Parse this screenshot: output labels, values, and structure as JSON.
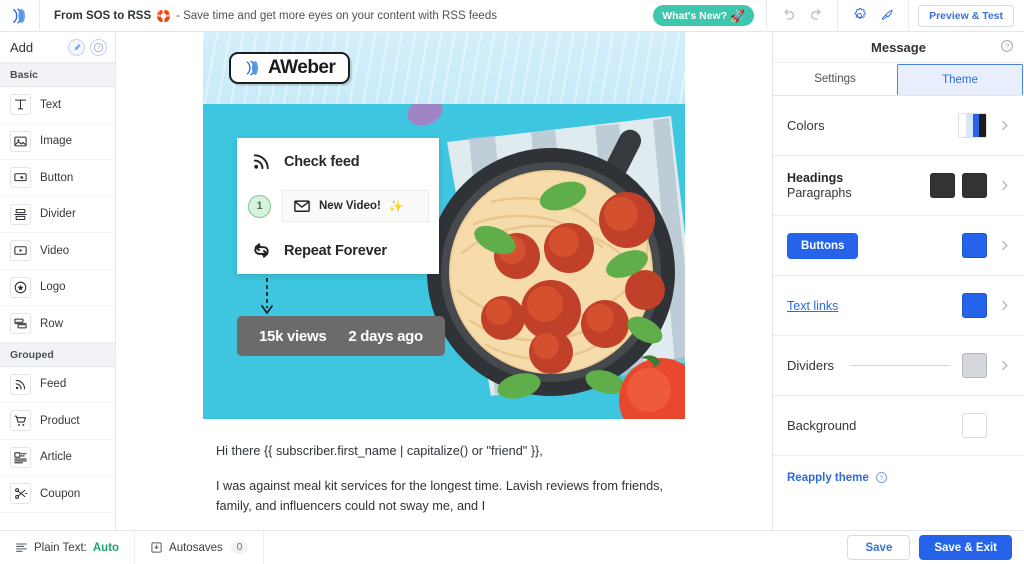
{
  "topbar": {
    "brand_icon": "aweber-logo-icon",
    "subject_strong": "From SOS to RSS",
    "subject_emoji": "🛟",
    "subject_rest": "- Save time and get more eyes on your content with RSS feeds",
    "whats_new_label": "What's New?",
    "whats_new_emoji": "🚀",
    "undo_icon": "undo-icon",
    "redo_icon": "redo-icon",
    "settings_icon": "gear-icon",
    "style_icon": "paintbrush-icon",
    "preview_label": "Preview & Test"
  },
  "sidebar": {
    "title": "Add",
    "pin_icon": "pin-icon",
    "help_icon": "help-icon",
    "sections": [
      {
        "label": "Basic",
        "items": [
          {
            "label": "Text",
            "icon": "text-icon"
          },
          {
            "label": "Image",
            "icon": "image-icon"
          },
          {
            "label": "Button",
            "icon": "button-icon"
          },
          {
            "label": "Divider",
            "icon": "divider-icon"
          },
          {
            "label": "Video",
            "icon": "video-icon"
          },
          {
            "label": "Logo",
            "icon": "logo-icon"
          },
          {
            "label": "Row",
            "icon": "row-icon"
          }
        ]
      },
      {
        "label": "Grouped",
        "items": [
          {
            "label": "Feed",
            "icon": "feed-icon"
          },
          {
            "label": "Product",
            "icon": "cart-icon"
          },
          {
            "label": "Article",
            "icon": "article-icon"
          },
          {
            "label": "Coupon",
            "icon": "coupon-icon"
          }
        ]
      }
    ]
  },
  "email": {
    "logo_text": "AWeber",
    "logo_icon": "aweber-logo-icon",
    "hero": {
      "flow_top_label": "Check feed",
      "flow_top_icon": "rss-feed-icon",
      "step_number": "1",
      "flow_mid_label": "New Video!",
      "flow_mid_emoji": "✨",
      "flow_mid_icon": "envelope-icon",
      "flow_bottom_label": "Repeat Forever",
      "flow_bottom_icon": "repeat-icon",
      "stat_views": "15k views",
      "stat_time": "2 days ago",
      "background_color": "#3ec6e0",
      "header_color": "#cfeefb",
      "photo_alt": "spaghetti and meatballs in a cast iron skillet"
    },
    "body_paragraphs": [
      "Hi there {{ subscriber.first_name | capitalize() or \"friend\" }},",
      "I was against meal kit services for the longest time. Lavish reviews from friends, family, and influencers could not sway me, and I"
    ]
  },
  "panel": {
    "title": "Message",
    "help_icon": "help-icon",
    "tabs": [
      {
        "label": "Settings",
        "active": false
      },
      {
        "label": "Theme",
        "active": true
      }
    ],
    "rows": [
      {
        "label": "Colors",
        "type": "strip",
        "swatches": [
          "#ffffff",
          "#d6e6f7",
          "#2563eb",
          "#1c1c1c"
        ],
        "chevron_icon": "chevron-right-icon"
      },
      {
        "label_head": "Headings",
        "label_sub": "Paragraphs",
        "type": "dual",
        "swatches": [
          "#333333",
          "#333333"
        ],
        "chevron_icon": "chevron-right-icon"
      },
      {
        "label": "Buttons",
        "type": "button",
        "swatches": [
          "#2563eb"
        ],
        "chevron_icon": "chevron-right-icon"
      },
      {
        "label": "Text links",
        "type": "link",
        "swatches": [
          "#2563eb"
        ],
        "chevron_icon": "chevron-right-icon"
      },
      {
        "label": "Dividers",
        "type": "divider",
        "swatches": [
          "#d4d7dc"
        ],
        "chevron_icon": "chevron-right-icon"
      },
      {
        "label": "Background",
        "type": "plain",
        "swatches": [
          "#ffffff"
        ],
        "chevron_icon": ""
      }
    ],
    "reapply_label": "Reapply theme",
    "reapply_help_icon": "help-icon"
  },
  "bottombar": {
    "plain_text_icon": "plain-text-icon",
    "plain_text_label": "Plain Text:",
    "plain_text_value": "Auto",
    "autosaves_icon": "autosave-icon",
    "autosaves_label": "Autosaves",
    "autosaves_count": "0",
    "save_label": "Save",
    "save_exit_label": "Save & Exit"
  }
}
